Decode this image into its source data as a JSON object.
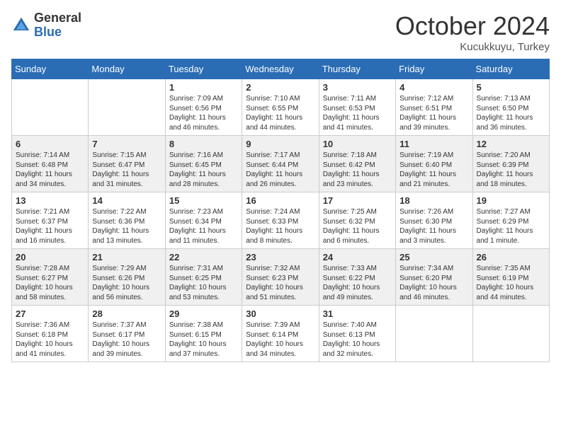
{
  "header": {
    "logo": {
      "general": "General",
      "blue": "Blue"
    },
    "month": "October 2024",
    "location": "Kucukkuyu, Turkey"
  },
  "weekdays": [
    "Sunday",
    "Monday",
    "Tuesday",
    "Wednesday",
    "Thursday",
    "Friday",
    "Saturday"
  ],
  "weeks": [
    [
      {
        "day": "",
        "sunrise": "",
        "sunset": "",
        "daylight": ""
      },
      {
        "day": "",
        "sunrise": "",
        "sunset": "",
        "daylight": ""
      },
      {
        "day": "1",
        "sunrise": "Sunrise: 7:09 AM",
        "sunset": "Sunset: 6:56 PM",
        "daylight": "Daylight: 11 hours and 46 minutes."
      },
      {
        "day": "2",
        "sunrise": "Sunrise: 7:10 AM",
        "sunset": "Sunset: 6:55 PM",
        "daylight": "Daylight: 11 hours and 44 minutes."
      },
      {
        "day": "3",
        "sunrise": "Sunrise: 7:11 AM",
        "sunset": "Sunset: 6:53 PM",
        "daylight": "Daylight: 11 hours and 41 minutes."
      },
      {
        "day": "4",
        "sunrise": "Sunrise: 7:12 AM",
        "sunset": "Sunset: 6:51 PM",
        "daylight": "Daylight: 11 hours and 39 minutes."
      },
      {
        "day": "5",
        "sunrise": "Sunrise: 7:13 AM",
        "sunset": "Sunset: 6:50 PM",
        "daylight": "Daylight: 11 hours and 36 minutes."
      }
    ],
    [
      {
        "day": "6",
        "sunrise": "Sunrise: 7:14 AM",
        "sunset": "Sunset: 6:48 PM",
        "daylight": "Daylight: 11 hours and 34 minutes."
      },
      {
        "day": "7",
        "sunrise": "Sunrise: 7:15 AM",
        "sunset": "Sunset: 6:47 PM",
        "daylight": "Daylight: 11 hours and 31 minutes."
      },
      {
        "day": "8",
        "sunrise": "Sunrise: 7:16 AM",
        "sunset": "Sunset: 6:45 PM",
        "daylight": "Daylight: 11 hours and 28 minutes."
      },
      {
        "day": "9",
        "sunrise": "Sunrise: 7:17 AM",
        "sunset": "Sunset: 6:44 PM",
        "daylight": "Daylight: 11 hours and 26 minutes."
      },
      {
        "day": "10",
        "sunrise": "Sunrise: 7:18 AM",
        "sunset": "Sunset: 6:42 PM",
        "daylight": "Daylight: 11 hours and 23 minutes."
      },
      {
        "day": "11",
        "sunrise": "Sunrise: 7:19 AM",
        "sunset": "Sunset: 6:40 PM",
        "daylight": "Daylight: 11 hours and 21 minutes."
      },
      {
        "day": "12",
        "sunrise": "Sunrise: 7:20 AM",
        "sunset": "Sunset: 6:39 PM",
        "daylight": "Daylight: 11 hours and 18 minutes."
      }
    ],
    [
      {
        "day": "13",
        "sunrise": "Sunrise: 7:21 AM",
        "sunset": "Sunset: 6:37 PM",
        "daylight": "Daylight: 11 hours and 16 minutes."
      },
      {
        "day": "14",
        "sunrise": "Sunrise: 7:22 AM",
        "sunset": "Sunset: 6:36 PM",
        "daylight": "Daylight: 11 hours and 13 minutes."
      },
      {
        "day": "15",
        "sunrise": "Sunrise: 7:23 AM",
        "sunset": "Sunset: 6:34 PM",
        "daylight": "Daylight: 11 hours and 11 minutes."
      },
      {
        "day": "16",
        "sunrise": "Sunrise: 7:24 AM",
        "sunset": "Sunset: 6:33 PM",
        "daylight": "Daylight: 11 hours and 8 minutes."
      },
      {
        "day": "17",
        "sunrise": "Sunrise: 7:25 AM",
        "sunset": "Sunset: 6:32 PM",
        "daylight": "Daylight: 11 hours and 6 minutes."
      },
      {
        "day": "18",
        "sunrise": "Sunrise: 7:26 AM",
        "sunset": "Sunset: 6:30 PM",
        "daylight": "Daylight: 11 hours and 3 minutes."
      },
      {
        "day": "19",
        "sunrise": "Sunrise: 7:27 AM",
        "sunset": "Sunset: 6:29 PM",
        "daylight": "Daylight: 11 hours and 1 minute."
      }
    ],
    [
      {
        "day": "20",
        "sunrise": "Sunrise: 7:28 AM",
        "sunset": "Sunset: 6:27 PM",
        "daylight": "Daylight: 10 hours and 58 minutes."
      },
      {
        "day": "21",
        "sunrise": "Sunrise: 7:29 AM",
        "sunset": "Sunset: 6:26 PM",
        "daylight": "Daylight: 10 hours and 56 minutes."
      },
      {
        "day": "22",
        "sunrise": "Sunrise: 7:31 AM",
        "sunset": "Sunset: 6:25 PM",
        "daylight": "Daylight: 10 hours and 53 minutes."
      },
      {
        "day": "23",
        "sunrise": "Sunrise: 7:32 AM",
        "sunset": "Sunset: 6:23 PM",
        "daylight": "Daylight: 10 hours and 51 minutes."
      },
      {
        "day": "24",
        "sunrise": "Sunrise: 7:33 AM",
        "sunset": "Sunset: 6:22 PM",
        "daylight": "Daylight: 10 hours and 49 minutes."
      },
      {
        "day": "25",
        "sunrise": "Sunrise: 7:34 AM",
        "sunset": "Sunset: 6:20 PM",
        "daylight": "Daylight: 10 hours and 46 minutes."
      },
      {
        "day": "26",
        "sunrise": "Sunrise: 7:35 AM",
        "sunset": "Sunset: 6:19 PM",
        "daylight": "Daylight: 10 hours and 44 minutes."
      }
    ],
    [
      {
        "day": "27",
        "sunrise": "Sunrise: 7:36 AM",
        "sunset": "Sunset: 6:18 PM",
        "daylight": "Daylight: 10 hours and 41 minutes."
      },
      {
        "day": "28",
        "sunrise": "Sunrise: 7:37 AM",
        "sunset": "Sunset: 6:17 PM",
        "daylight": "Daylight: 10 hours and 39 minutes."
      },
      {
        "day": "29",
        "sunrise": "Sunrise: 7:38 AM",
        "sunset": "Sunset: 6:15 PM",
        "daylight": "Daylight: 10 hours and 37 minutes."
      },
      {
        "day": "30",
        "sunrise": "Sunrise: 7:39 AM",
        "sunset": "Sunset: 6:14 PM",
        "daylight": "Daylight: 10 hours and 34 minutes."
      },
      {
        "day": "31",
        "sunrise": "Sunrise: 7:40 AM",
        "sunset": "Sunset: 6:13 PM",
        "daylight": "Daylight: 10 hours and 32 minutes."
      },
      {
        "day": "",
        "sunrise": "",
        "sunset": "",
        "daylight": ""
      },
      {
        "day": "",
        "sunrise": "",
        "sunset": "",
        "daylight": ""
      }
    ]
  ]
}
